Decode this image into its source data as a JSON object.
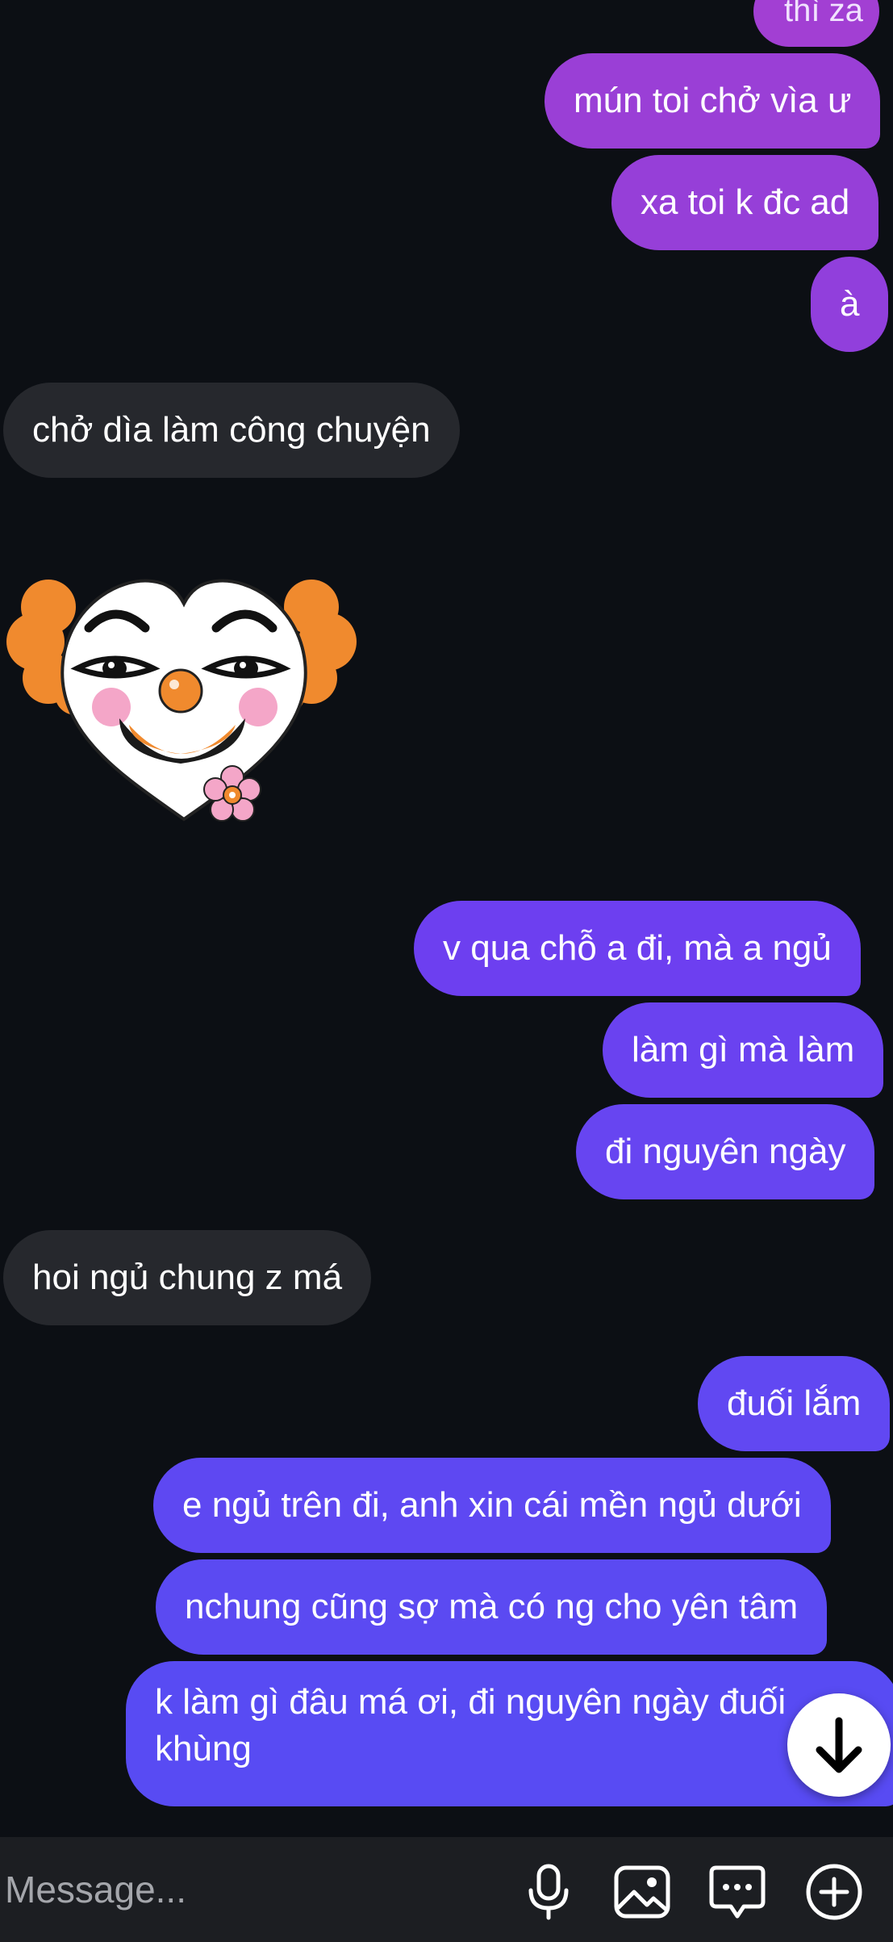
{
  "conversation": {
    "messages": [
      {
        "from": "me",
        "text": "thì za",
        "style": "partial"
      },
      {
        "from": "me",
        "text": "mún toi chở vìa ư"
      },
      {
        "from": "me",
        "text": "xa toi k đc ad"
      },
      {
        "from": "me",
        "text": "à"
      },
      {
        "from": "them",
        "text": "chở dìa làm công chuyện"
      },
      {
        "from": "them",
        "sticker": "clown-heart-sticker"
      },
      {
        "from": "me",
        "text": "v qua chỗ a đi, mà a ngủ"
      },
      {
        "from": "me",
        "text": "làm gì mà làm"
      },
      {
        "from": "me",
        "text": "đi nguyên ngày"
      },
      {
        "from": "them",
        "text": "hoi ngủ chung z má"
      },
      {
        "from": "me",
        "text": "đuối lắm"
      },
      {
        "from": "me",
        "text": "e ngủ trên đi, anh xin cái mền ngủ dưới"
      },
      {
        "from": "me",
        "text": "nchung cũng sợ mà có ng cho yên tâm"
      },
      {
        "from": "me",
        "text": "k làm gì đâu má ơi, đi nguyên ngày đuối khùng"
      }
    ]
  },
  "composer": {
    "placeholder": "Message...",
    "icons": [
      "microphone-icon",
      "image-icon",
      "sticker-icon",
      "plus-icon"
    ]
  },
  "scroll_button": {
    "icon": "arrow-down-icon"
  },
  "colors": {
    "background": "#0c0f14",
    "incoming_bubble": "#26282d",
    "outgoing_top": "#9a3fd6",
    "outgoing_bottom": "#5a4af0"
  }
}
